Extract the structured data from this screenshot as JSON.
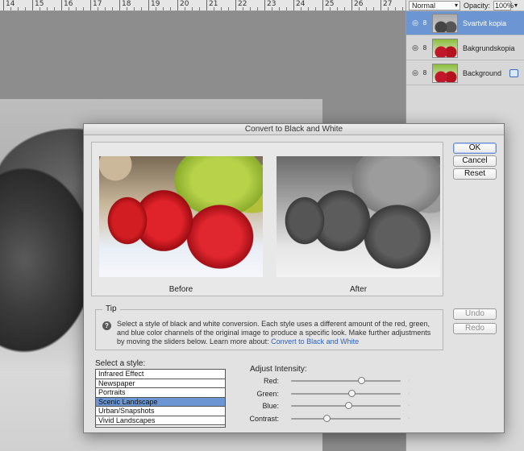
{
  "ruler": {
    "ticks": [
      "14",
      "15",
      "16",
      "17",
      "18",
      "19",
      "20",
      "21",
      "22",
      "23",
      "24",
      "25",
      "26",
      "27"
    ]
  },
  "layers_panel": {
    "blend_mode": "Normal",
    "opacity_label": "Opacity:",
    "opacity_value": "100%",
    "layers": [
      {
        "name": "Svartvit kopia",
        "thumb": "bw",
        "active": true
      },
      {
        "name": "Bakgrundskopia",
        "thumb": "color",
        "active": false
      },
      {
        "name": "Background",
        "thumb": "color",
        "active": false,
        "locked": true
      }
    ],
    "eye_icon_glyph": "◎",
    "chain_icon_glyph": "8"
  },
  "dialog": {
    "title": "Convert to Black and White",
    "before_label": "Before",
    "after_label": "After",
    "buttons": {
      "ok": "OK",
      "cancel": "Cancel",
      "reset": "Reset",
      "undo": "Undo",
      "redo": "Redo"
    },
    "tip": {
      "title": "Tip",
      "icon_glyph": "?",
      "text": "Select a style of black and white conversion. Each style uses a different amount of the red, green, and blue color channels of the original image to produce a specific look. Make further adjustments by moving the sliders below. Learn more about: ",
      "link": "Convert to Black and White"
    },
    "style_label": "Select a style:",
    "styles": [
      "Infrared Effect",
      "Newspaper",
      "Portraits",
      "Scenic Landscape",
      "Urban/Snapshots",
      "Vivid Landscapes"
    ],
    "selected_style": "Scenic Landscape",
    "adjust_label": "Adjust Intensity:",
    "sliders": [
      {
        "name": "Red:",
        "value": 0.64
      },
      {
        "name": "Green:",
        "value": 0.55
      },
      {
        "name": "Blue:",
        "value": 0.52
      },
      {
        "name": "Contrast:",
        "value": 0.32
      }
    ],
    "slider_end_glyph": "·"
  }
}
